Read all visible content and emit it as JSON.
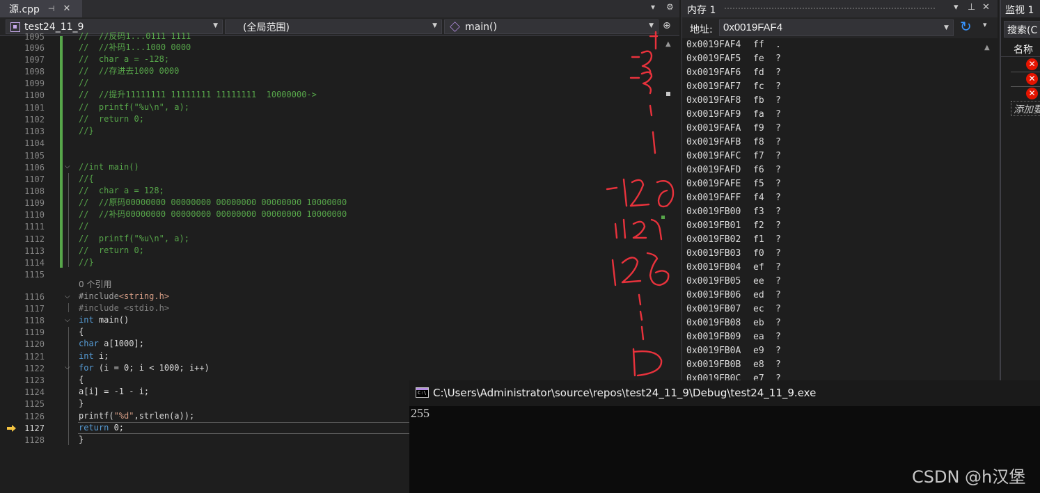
{
  "doc_tab": {
    "filename": "源.cpp",
    "pin": "⊣",
    "close": "✕"
  },
  "nav": {
    "project": "test24_11_9",
    "scope": "(全局范围)",
    "function": "main()"
  },
  "gutter": {
    "line_numbers": [
      "1095",
      "1096",
      "1097",
      "1098",
      "1099",
      "1100",
      "1101",
      "1102",
      "1103",
      "1104",
      "1105",
      "1106",
      "1107",
      "1108",
      "1109",
      "1110",
      "1111",
      "1112",
      "1113",
      "1114",
      "1115",
      "",
      "1116",
      "1117",
      "1118",
      "1119",
      "1120",
      "1121",
      "1122",
      "1123",
      "1124",
      "1125",
      "1126",
      "1127",
      "1128"
    ],
    "current_line": "1127"
  },
  "code": {
    "l1095": "//  //反码1...0111 1111",
    "l1096": "//  //补码1...1000 0000",
    "l1097": "//  char a = -128;",
    "l1098": "//  //存进去1000 0000",
    "l1099": "//",
    "l1100": "//  //提升11111111 11111111 11111111  10000000->",
    "l1101": "//  printf(\"%u\\n\", a);",
    "l1102": "//  return 0;",
    "l1103": "//}",
    "l1106": "//int main()",
    "l1107": "//{",
    "l1108": "//  char a = 128;",
    "l1109": "//  //原码00000000 00000000 00000000 00000000 10000000",
    "l1110": "//  //补码00000000 00000000 00000000 00000000 10000000",
    "l1111": "//",
    "l1112": "//  printf(\"%u\\n\", a);",
    "l1113": "//  return 0;",
    "l1114": "//}",
    "refs": "0 个引用",
    "l1116a": "#include",
    "l1116b": "<string.h>",
    "l1117": "#include <stdio.h>",
    "l1118a": "int",
    "l1118b": " main()",
    "l1119": "{",
    "l1120a": "char",
    "l1120b": " a[1000];",
    "l1121a": "int",
    "l1121b": " i;",
    "l1122a": "for",
    "l1122b": " (i = 0; i < 1000; i++)",
    "l1123": "{",
    "l1124": "a[i] = -1 - i;",
    "l1125": "}",
    "l1126a": "printf(",
    "l1126b": "\"%d\"",
    "l1126c": ",strlen(a));",
    "l1127a": "return",
    "l1127b": " 0;",
    "l1128": "}"
  },
  "memory": {
    "title": "内存 1",
    "address_label": "地址:",
    "address_value": "0x0019FAF4",
    "rows": [
      {
        "addr": "0x0019FAF4",
        "hex": "ff",
        "ch": "."
      },
      {
        "addr": "0x0019FAF5",
        "hex": "fe",
        "ch": "?"
      },
      {
        "addr": "0x0019FAF6",
        "hex": "fd",
        "ch": "?"
      },
      {
        "addr": "0x0019FAF7",
        "hex": "fc",
        "ch": "?"
      },
      {
        "addr": "0x0019FAF8",
        "hex": "fb",
        "ch": "?"
      },
      {
        "addr": "0x0019FAF9",
        "hex": "fa",
        "ch": "?"
      },
      {
        "addr": "0x0019FAFA",
        "hex": "f9",
        "ch": "?"
      },
      {
        "addr": "0x0019FAFB",
        "hex": "f8",
        "ch": "?"
      },
      {
        "addr": "0x0019FAFC",
        "hex": "f7",
        "ch": "?"
      },
      {
        "addr": "0x0019FAFD",
        "hex": "f6",
        "ch": "?"
      },
      {
        "addr": "0x0019FAFE",
        "hex": "f5",
        "ch": "?"
      },
      {
        "addr": "0x0019FAFF",
        "hex": "f4",
        "ch": "?"
      },
      {
        "addr": "0x0019FB00",
        "hex": "f3",
        "ch": "?"
      },
      {
        "addr": "0x0019FB01",
        "hex": "f2",
        "ch": "?"
      },
      {
        "addr": "0x0019FB02",
        "hex": "f1",
        "ch": "?"
      },
      {
        "addr": "0x0019FB03",
        "hex": "f0",
        "ch": "?"
      },
      {
        "addr": "0x0019FB04",
        "hex": "ef",
        "ch": "?"
      },
      {
        "addr": "0x0019FB05",
        "hex": "ee",
        "ch": "?"
      },
      {
        "addr": "0x0019FB06",
        "hex": "ed",
        "ch": "?"
      },
      {
        "addr": "0x0019FB07",
        "hex": "ec",
        "ch": "?"
      },
      {
        "addr": "0x0019FB08",
        "hex": "eb",
        "ch": "?"
      },
      {
        "addr": "0x0019FB09",
        "hex": "ea",
        "ch": "?"
      },
      {
        "addr": "0x0019FB0A",
        "hex": "e9",
        "ch": "?"
      },
      {
        "addr": "0x0019FB0B",
        "hex": "e8",
        "ch": "?"
      },
      {
        "addr": "0x0019FB0C",
        "hex": "e7",
        "ch": "?"
      }
    ]
  },
  "watch": {
    "title": "监视 1",
    "search": "搜索(C",
    "col_name": "名称",
    "add_item": "添加要"
  },
  "console": {
    "title": "C:\\Users\\Administrator\\source\\repos\\test24_11_9\\Debug\\test24_11_9.exe",
    "icon_text": "C:\\",
    "output": "255"
  },
  "watermark": "CSDN @h汉堡",
  "handwriting": [
    "-1",
    "-2",
    "-3",
    "-128",
    "127",
    "126",
    "0"
  ],
  "colors": {
    "comment": "#57a64a",
    "keyword": "#569cd6",
    "string": "#d69d85",
    "ink": "#e8323c",
    "refresh": "#3794ff",
    "error": "#e51400"
  }
}
